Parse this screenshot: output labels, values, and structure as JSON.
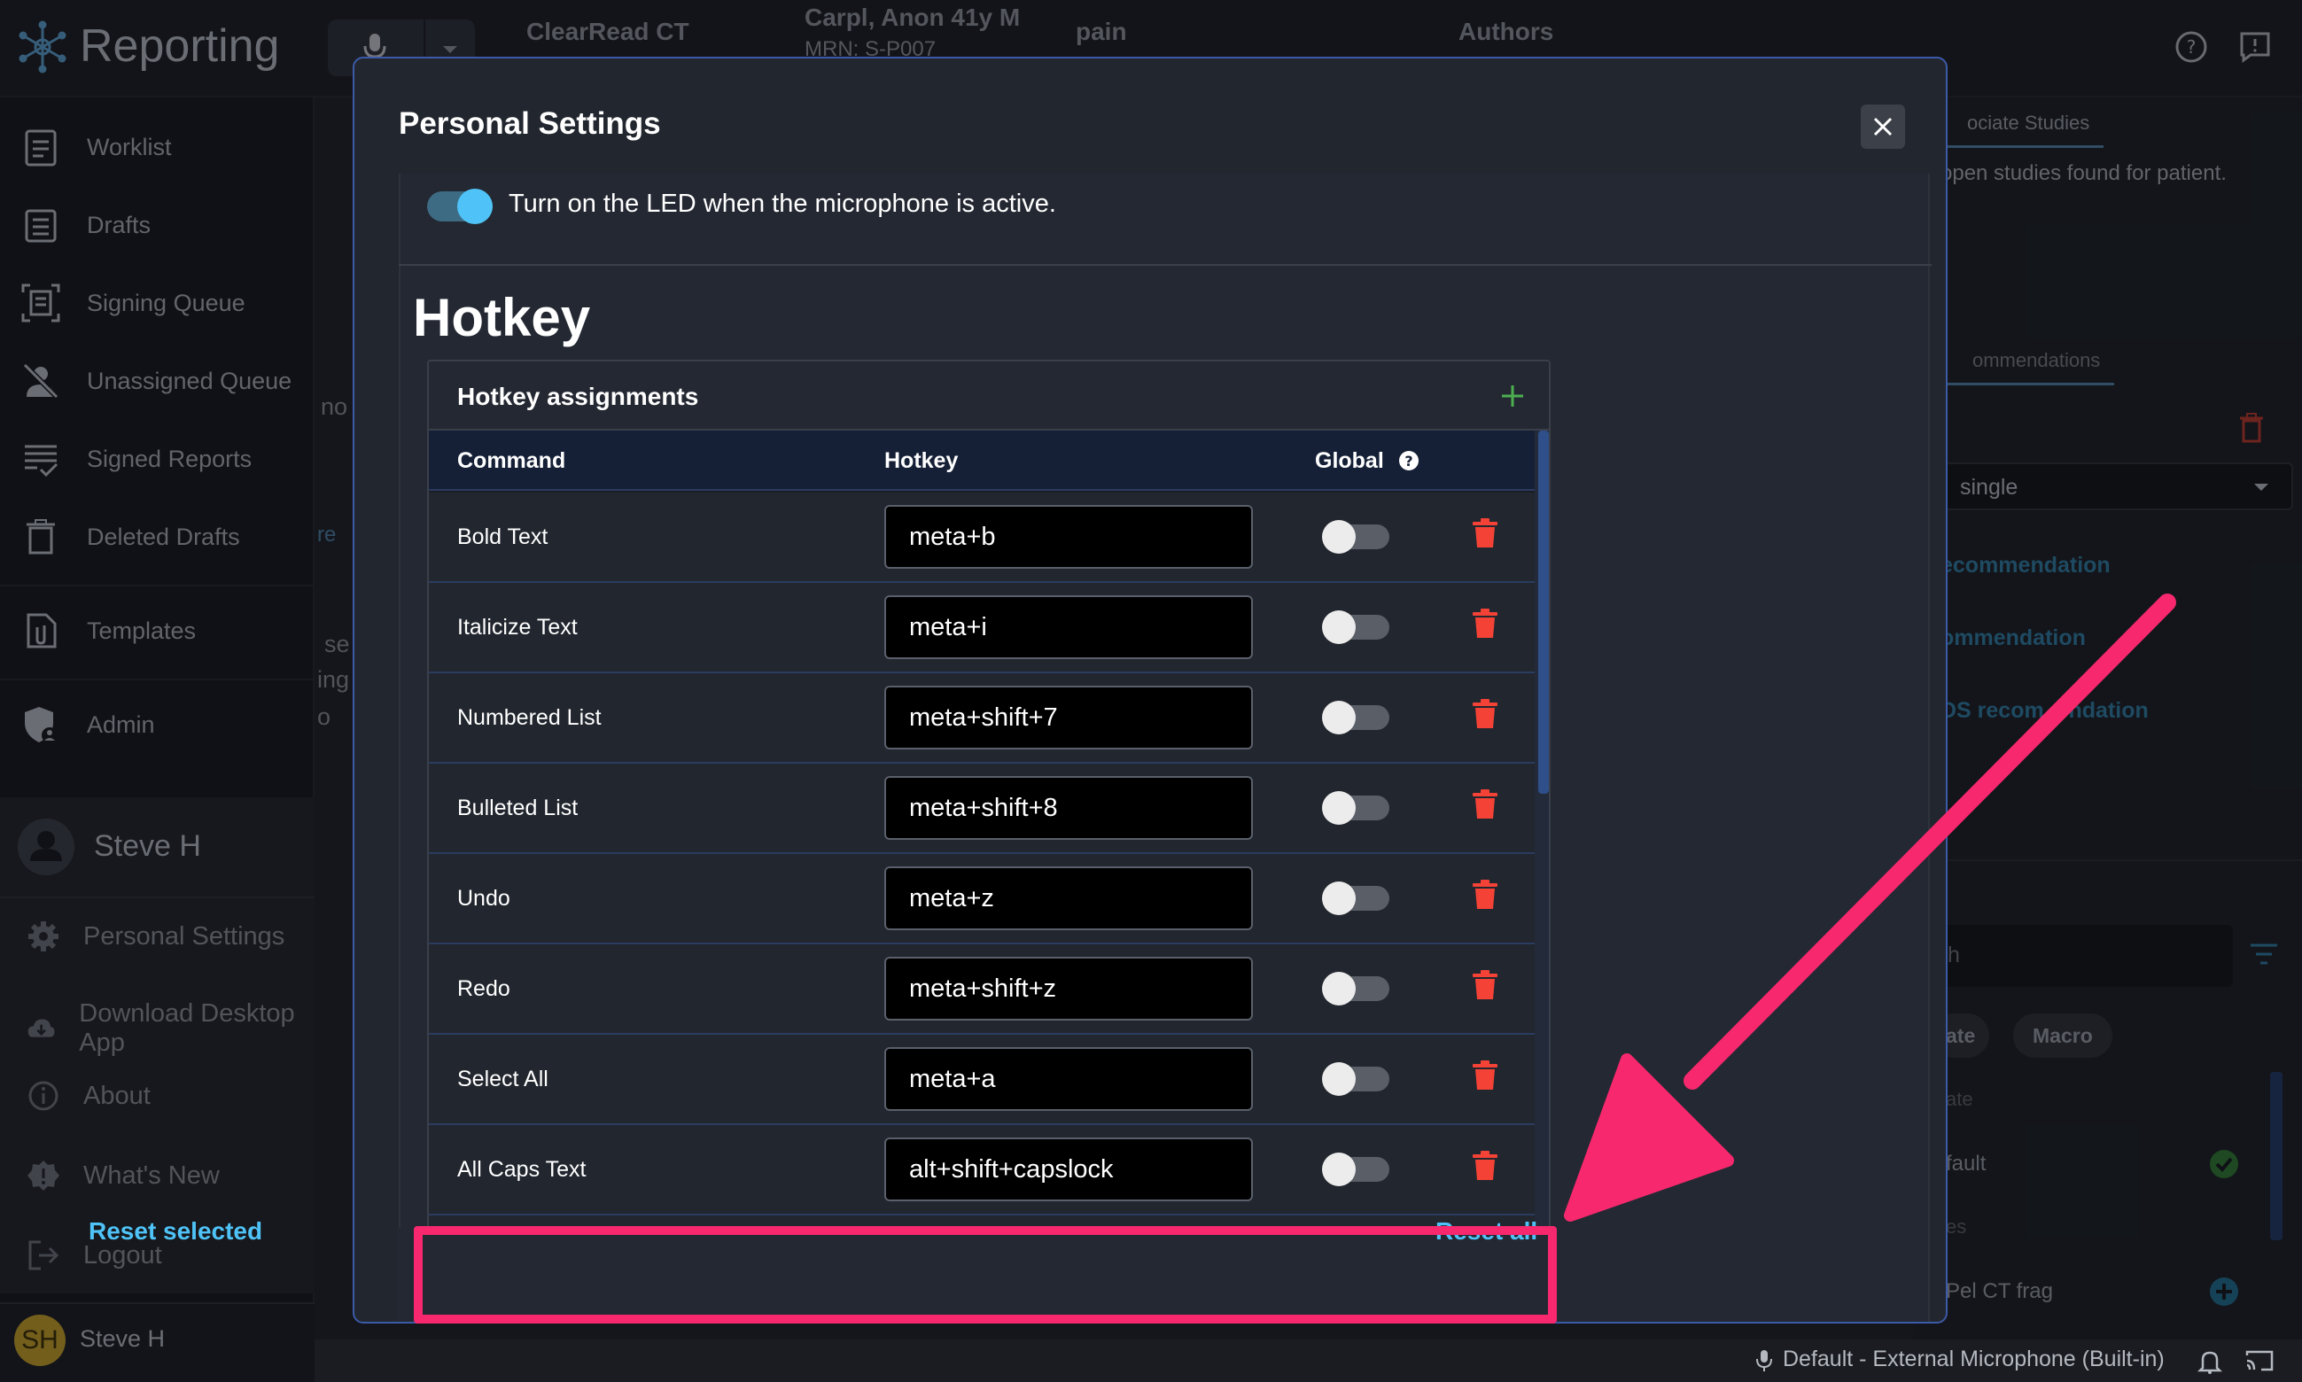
{
  "app": {
    "title": "Reporting",
    "user_name": "Steve H",
    "user_initials": "SH"
  },
  "header": {
    "product": "ClearRead CT",
    "patient": "Carpl, Anon 41y M",
    "mrn": "MRN: S-P007",
    "finding": "pain",
    "authors": "Authors"
  },
  "sidebar": {
    "items": [
      {
        "label": "Worklist",
        "icon": "worklist-icon"
      },
      {
        "label": "Drafts",
        "icon": "drafts-icon"
      },
      {
        "label": "Signing Queue",
        "icon": "signing-queue-icon"
      },
      {
        "label": "Unassigned Queue",
        "icon": "unassigned-queue-icon"
      },
      {
        "label": "Signed Reports",
        "icon": "signed-reports-icon"
      },
      {
        "label": "Deleted Drafts",
        "icon": "trash-icon"
      },
      {
        "label": "Templates",
        "icon": "templates-icon"
      },
      {
        "label": "Admin",
        "icon": "admin-shield-icon"
      }
    ],
    "user_menu": {
      "name": "Steve H",
      "items": [
        {
          "label": "Personal Settings",
          "icon": "gear-icon"
        },
        {
          "label": "Download Desktop App",
          "icon": "cloud-download-icon"
        },
        {
          "label": "About",
          "icon": "info-icon"
        },
        {
          "label": "What's New",
          "icon": "badge-icon"
        },
        {
          "label": "Logout",
          "icon": "logout-icon"
        }
      ]
    }
  },
  "background_fragments": {
    "f1": "no",
    "f2": "re",
    "f3": "se",
    "f4": "ing",
    "f5": "o"
  },
  "right_panel": {
    "tab1": "ociate Studies",
    "no_studies": "open studies found for patient.",
    "tab2": "ommendations",
    "select_value": "single",
    "link1": "ecommendation",
    "link2": "ommendation",
    "link3": "DS recom    ndation",
    "search_fragment": "h",
    "chip1": "ate",
    "chip2": "Macro",
    "list_header": "ate",
    "list_item1": "fault",
    "list_section": "es",
    "list_item2": "Pel CT frag"
  },
  "modal": {
    "title": "Personal Settings",
    "led_toggle_label": "Turn on the LED when the microphone is active.",
    "section_title": "Hotkey",
    "card_title": "Hotkey assignments",
    "columns": {
      "command": "Command",
      "hotkey": "Hotkey",
      "global": "Global"
    },
    "rows": [
      {
        "command": "Bold Text",
        "hotkey": "meta+b",
        "global": false
      },
      {
        "command": "Italicize Text",
        "hotkey": "meta+i",
        "global": false
      },
      {
        "command": "Numbered List",
        "hotkey": "meta+shift+7",
        "global": false
      },
      {
        "command": "Bulleted List",
        "hotkey": "meta+shift+8",
        "global": false
      },
      {
        "command": "Undo",
        "hotkey": "meta+z",
        "global": false
      },
      {
        "command": "Redo",
        "hotkey": "meta+shift+z",
        "global": false
      },
      {
        "command": "Select All",
        "hotkey": "meta+a",
        "global": false
      },
      {
        "command": "All Caps Text",
        "hotkey": "alt+shift+capslock",
        "global": false
      }
    ],
    "reset_selected": "Reset selected",
    "reset_all": "Reset all"
  },
  "status_bar": {
    "microphone": "Default - External Microphone (Built-in)"
  },
  "colors": {
    "accent": "#4fc3f7",
    "highlight": "#f7286e",
    "delete": "#f44336",
    "add": "#4caf50"
  }
}
